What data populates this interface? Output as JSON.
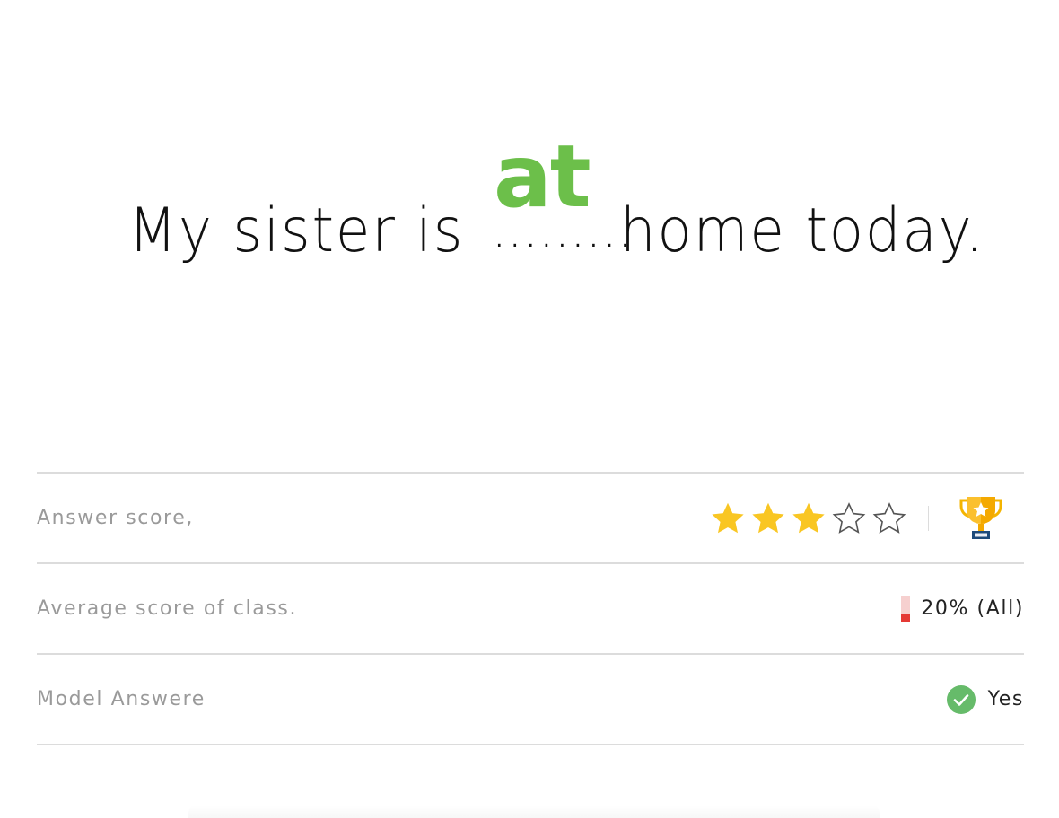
{
  "sentence": {
    "before": "My sister is",
    "blank": ".........",
    "answer": "at",
    "after": "home today."
  },
  "rows": {
    "answer_score": {
      "label": "Answer score,",
      "stars_filled": 3,
      "stars_total": 5,
      "star_color": "#f9c623",
      "trophy_icon": "trophy-icon"
    },
    "average_score": {
      "label": "Average score of class.",
      "value_text": "20% (All)",
      "fill_fraction": 0.2,
      "bar_color": "#e53935"
    },
    "model_answer": {
      "label": "Model Answere",
      "value_text": "Yes",
      "check_color": "#66bb6a",
      "icon": "check-circle-icon"
    }
  },
  "colors": {
    "answer_green": "#6cbf4a",
    "divider": "#dcdcdc",
    "label_gray": "#9a9a9a"
  }
}
